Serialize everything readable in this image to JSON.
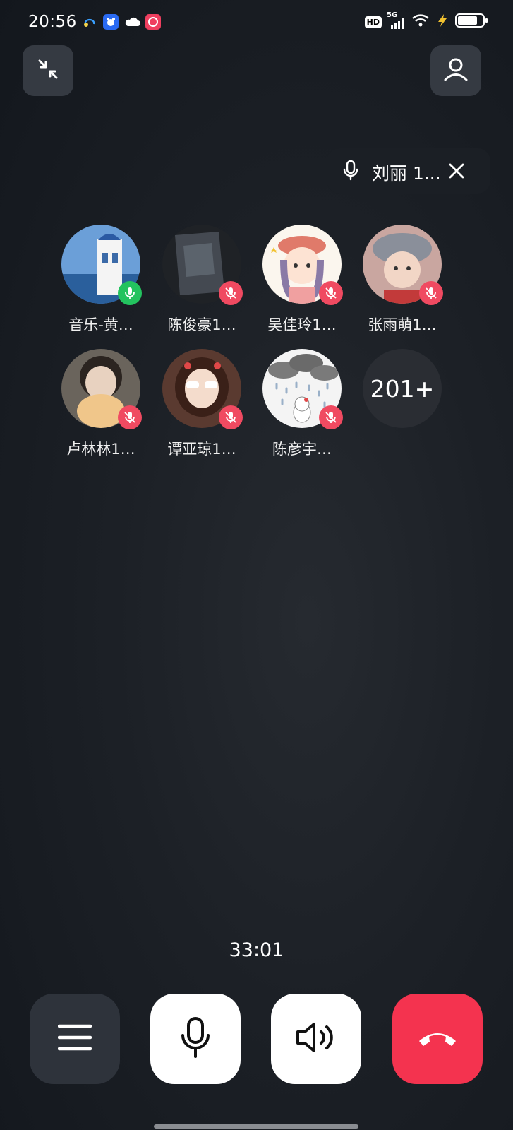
{
  "status": {
    "time": "20:56",
    "hd": "HD",
    "network": "5G",
    "app_icons": [
      "headphones-app-icon",
      "baidu-app-icon",
      "weather-cloud-icon",
      "red-app-icon"
    ]
  },
  "header": {
    "minimize_icon": "minimize-arrows-icon",
    "person_icon": "person-icon"
  },
  "speaker_pill": {
    "name": "刘丽 1...",
    "mic_icon": "microphone-icon",
    "close_icon": "close-icon"
  },
  "members": [
    {
      "name": "音乐-黄…",
      "mic": "on",
      "mic_color": "#23c35f"
    },
    {
      "name": "陈俊豪1…",
      "mic": "muted",
      "mic_color": "#f04a61"
    },
    {
      "name": "吴佳玲1…",
      "mic": "muted",
      "mic_color": "#f04a61"
    },
    {
      "name": "张雨萌1…",
      "mic": "muted",
      "mic_color": "#f04a61"
    },
    {
      "name": "卢林林1…",
      "mic": "muted",
      "mic_color": "#f04a61"
    },
    {
      "name": "谭亚琼1…",
      "mic": "muted",
      "mic_color": "#f04a61"
    },
    {
      "name": "陈彦宇…",
      "mic": "muted",
      "mic_color": "#f04a61"
    }
  ],
  "more_count": "201+",
  "call": {
    "timer": "33:01"
  },
  "controls": {
    "menu_icon": "menu-icon",
    "mic_icon": "microphone-icon",
    "speaker_icon": "speaker-icon",
    "hangup_icon": "hangup-phone-icon",
    "hangup_color": "#f4334f"
  }
}
